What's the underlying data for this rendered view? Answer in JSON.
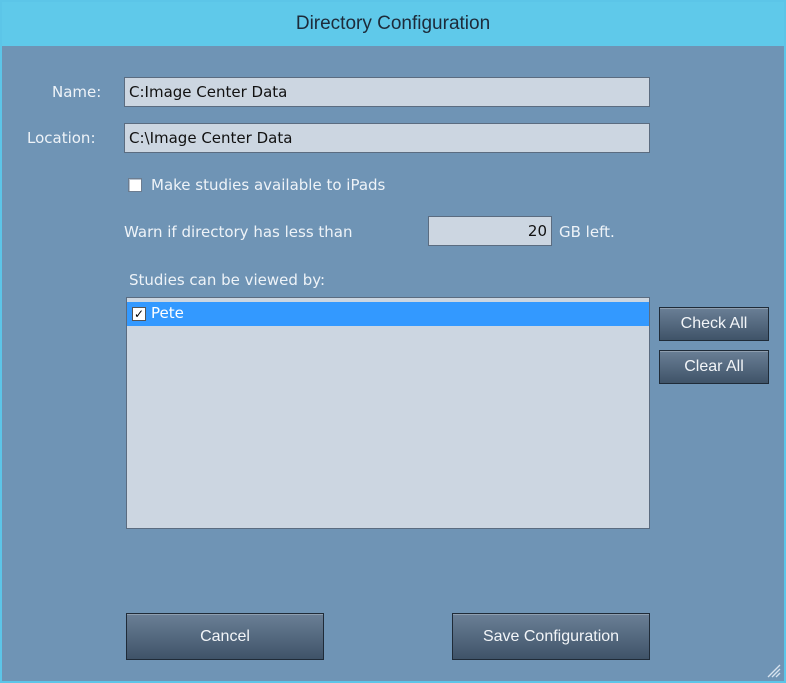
{
  "window": {
    "title": "Directory Configuration"
  },
  "form": {
    "name_label": "Name:",
    "name_value": "C:Image Center Data",
    "location_label": "Location:",
    "location_value": "C:\\Image Center Data",
    "ipad_label": "Make studies available to iPads",
    "ipad_checked": false,
    "warn_prefix": "Warn if directory has less than",
    "warn_value": "20",
    "warn_suffix": "GB left.",
    "viewers_label": "Studies can be viewed by:"
  },
  "viewers": {
    "items": [
      {
        "name": "Pete",
        "checked": true,
        "selected": true
      }
    ],
    "check_mark": "✓"
  },
  "buttons": {
    "check_all": "Check All",
    "clear_all": "Clear All",
    "cancel": "Cancel",
    "save": "Save Configuration"
  },
  "colors": {
    "titlebar": "#5fc9ea",
    "body": "#6f94b5",
    "selection": "#3399ff"
  }
}
